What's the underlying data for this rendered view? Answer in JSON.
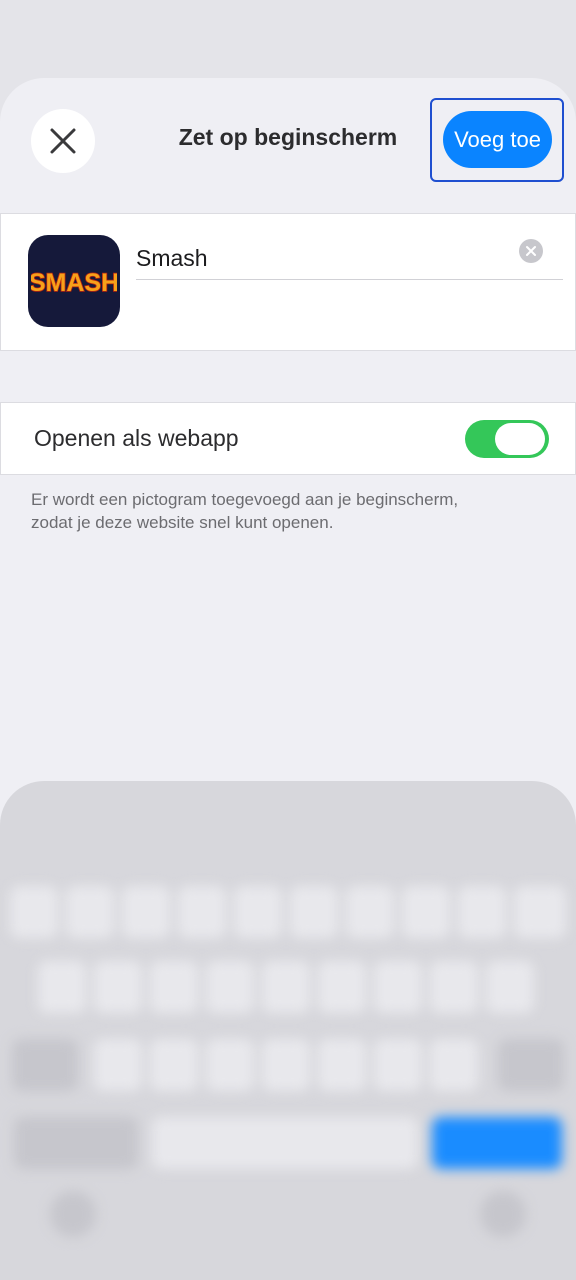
{
  "header": {
    "title": "Zet op beginscherm",
    "add_label": "Voeg toe",
    "close_icon": "close-icon"
  },
  "app": {
    "icon_text": "SMASH",
    "icon_colors": {
      "background": "#15193a",
      "text_fill": "#f6a11a",
      "text_stroke": "#b8240f"
    },
    "name_value": "Smash",
    "clear_icon": "clear-icon"
  },
  "webapp": {
    "label": "Openen als webapp",
    "enabled": true,
    "toggle_color": "#34c759"
  },
  "helper_text": "Er wordt een pictogram toegevoegd aan je beginscherm, zodat je deze website snel kunt openen.",
  "colors": {
    "accent": "#0a84ff",
    "focus_outline": "#1f4fd0",
    "sheet_bg": "#efeff4"
  }
}
